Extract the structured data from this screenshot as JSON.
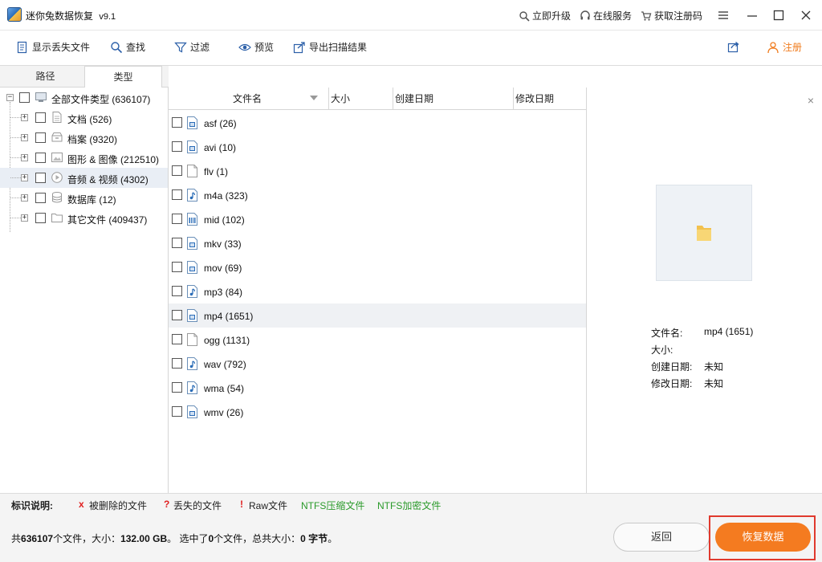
{
  "window": {
    "title": "迷你兔数据恢复",
    "version": "v9.1"
  },
  "title_links": {
    "upgrade": "立即升级",
    "online_service": "在线服务",
    "get_code": "获取注册码"
  },
  "toolbar": {
    "show_lost": "显示丢失文件",
    "find": "查找",
    "filter": "过滤",
    "preview": "预览",
    "export": "导出扫描结果",
    "register": "注册"
  },
  "tabs": {
    "path": "路径",
    "type": "类型",
    "active": "类型"
  },
  "tree": {
    "root": "全部文件类型 (636107)",
    "children": [
      {
        "label": "文档 (526)",
        "icon": "document-icon"
      },
      {
        "label": "档案 (9320)",
        "icon": "archive-icon"
      },
      {
        "label": "图形 & 图像 (212510)",
        "icon": "image-icon"
      },
      {
        "label": "音频 & 视频 (4302)",
        "icon": "media-icon",
        "selected": true
      },
      {
        "label": "数据库 (12)",
        "icon": "database-icon"
      },
      {
        "label": "其它文件 (409437)",
        "icon": "folder-icon"
      }
    ]
  },
  "columns": {
    "name": "文件名",
    "size": "大小",
    "created": "创建日期",
    "modified": "修改日期"
  },
  "files": [
    {
      "label": "asf (26)",
      "icon": "video-file-icon"
    },
    {
      "label": "avi (10)",
      "icon": "video-file-icon"
    },
    {
      "label": "flv (1)",
      "icon": "blank-file-icon"
    },
    {
      "label": "m4a (323)",
      "icon": "audio-file-icon"
    },
    {
      "label": "mid (102)",
      "icon": "midi-file-icon"
    },
    {
      "label": "mkv (33)",
      "icon": "video-file-icon"
    },
    {
      "label": "mov (69)",
      "icon": "video-file-icon"
    },
    {
      "label": "mp3 (84)",
      "icon": "audio-file-icon"
    },
    {
      "label": "mp4 (1651)",
      "icon": "video-file-icon",
      "selected": true
    },
    {
      "label": "ogg (1131)",
      "icon": "blank-file-icon"
    },
    {
      "label": "wav (792)",
      "icon": "audio-file-icon"
    },
    {
      "label": "wma (54)",
      "icon": "audio-file-icon"
    },
    {
      "label": "wmv (26)",
      "icon": "video-file-icon"
    }
  ],
  "preview": {
    "name_label": "文件名:",
    "name_value": "mp4 (1651)",
    "size_label": "大小:",
    "size_value": "",
    "created_label": "创建日期:",
    "created_value": "未知",
    "modified_label": "修改日期:",
    "modified_value": "未知"
  },
  "legend": {
    "title": "标识说明:",
    "deleted_mark": "x",
    "deleted": "被删除的文件",
    "lost_mark": "?",
    "lost": "丢失的文件",
    "raw_mark": "!",
    "raw": "Raw文件",
    "ntfs_compressed": "NTFS压缩文件",
    "ntfs_encrypted": "NTFS加密文件"
  },
  "status": {
    "p1": "共",
    "total_files": "636107",
    "p2": "个文件，大小：",
    "total_size": "132.00 GB",
    "p3": "。 选中了",
    "selected_count": "0",
    "p4": "个文件，总共大小：",
    "selected_size": "0 字节",
    "p5": "。"
  },
  "buttons": {
    "back": "返回",
    "recover": "恢复数据"
  },
  "colors": {
    "accent_orange": "#f47b20",
    "highlight_red": "#e03a2e",
    "ntfs_green": "#2a9a2a",
    "mark_red": "#e02020"
  }
}
